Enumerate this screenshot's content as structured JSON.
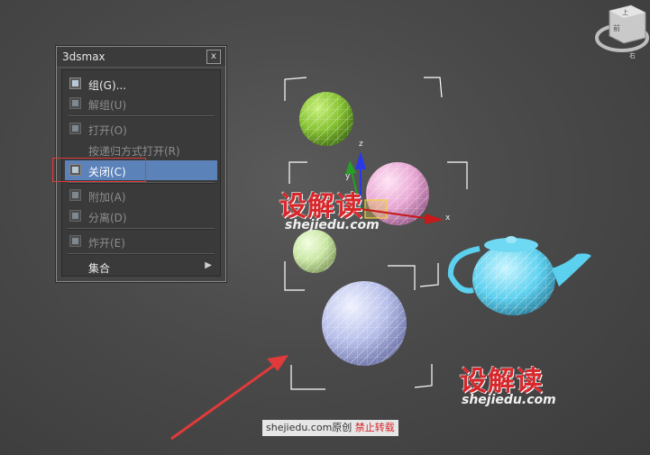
{
  "menu": {
    "title": "3dsmax",
    "close_glyph": "x",
    "items": [
      {
        "label": "组(G)...",
        "enabled": true,
        "icon": "group-icon"
      },
      {
        "label": "解组(U)",
        "enabled": false,
        "icon": "ungroup-icon"
      },
      {
        "label": "打开(O)",
        "enabled": false,
        "icon": "open-group-icon"
      },
      {
        "label": "按递归方式打开(R)",
        "enabled": false,
        "icon": ""
      },
      {
        "label": "关闭(C)",
        "enabled": true,
        "selected": true,
        "icon": "close-group-icon"
      },
      {
        "label": "附加(A)",
        "enabled": false,
        "icon": "attach-icon"
      },
      {
        "label": "分离(D)",
        "enabled": false,
        "icon": "detach-icon"
      },
      {
        "label": "炸开(E)",
        "enabled": false,
        "icon": "explode-icon"
      },
      {
        "label": "集合",
        "enabled": true,
        "submenu": true,
        "icon": ""
      }
    ]
  },
  "viewport": {
    "axis_labels": {
      "x": "x",
      "y": "y",
      "z": "z"
    },
    "objects": [
      "green-sphere",
      "pink-sphere",
      "lightgreen-sphere",
      "blue-sphere",
      "teapot"
    ]
  },
  "viewcube": {
    "top_label": "上",
    "front_label": "前",
    "right_label": "右"
  },
  "watermark": {
    "main": "设解读",
    "site": "shejiedu.com"
  },
  "copyright": {
    "site": "shejiedu.com",
    "original": "原创",
    "notice": "禁止转载"
  },
  "colors": {
    "selection": "#5b82b9",
    "highlight_box": "#e03a3a",
    "arrow": "#e03a3a",
    "watermark": "#d9262b"
  }
}
